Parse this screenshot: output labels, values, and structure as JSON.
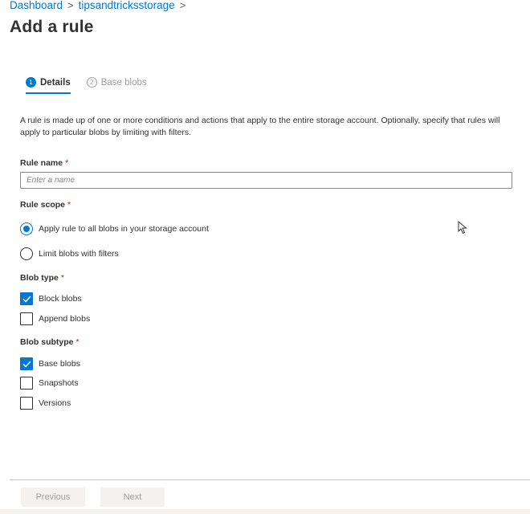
{
  "breadcrumb": {
    "items": [
      "Dashboard",
      "tipsandtricksstorage"
    ],
    "separator": ">"
  },
  "page_title": "Add a rule",
  "tabs": [
    {
      "number": "1",
      "label": "Details",
      "active": true
    },
    {
      "number": "2",
      "label": "Base blobs",
      "active": false
    }
  ],
  "description": "A rule is made up of one or more conditions and actions that apply to the entire storage account. Optionally, specify that rules will apply to particular blobs by limiting with filters.",
  "rule_name": {
    "label": "Rule name",
    "required_marker": "*",
    "value": "",
    "placeholder": "Enter a name"
  },
  "rule_scope": {
    "label": "Rule scope",
    "required_marker": "*",
    "options": [
      {
        "label": "Apply rule to all blobs in your storage account",
        "selected": true
      },
      {
        "label": "Limit blobs with filters",
        "selected": false
      }
    ]
  },
  "blob_type": {
    "label": "Blob type",
    "required_marker": "*",
    "options": [
      {
        "label": "Block blobs",
        "checked": true
      },
      {
        "label": "Append blobs",
        "checked": false
      }
    ]
  },
  "blob_subtype": {
    "label": "Blob subtype",
    "required_marker": "*",
    "options": [
      {
        "label": "Base blobs",
        "checked": true
      },
      {
        "label": "Snapshots",
        "checked": false
      },
      {
        "label": "Versions",
        "checked": false
      }
    ]
  },
  "footer": {
    "previous_label": "Previous",
    "next_label": "Next"
  },
  "colors": {
    "accent": "#0078d4",
    "required": "#a4262c",
    "disabled_text": "#a19f9d"
  },
  "icons": {
    "cursor": "mouse-pointer-icon",
    "check": "checkmark-icon",
    "breadcrumb_separator": "chevron-right-icon"
  }
}
